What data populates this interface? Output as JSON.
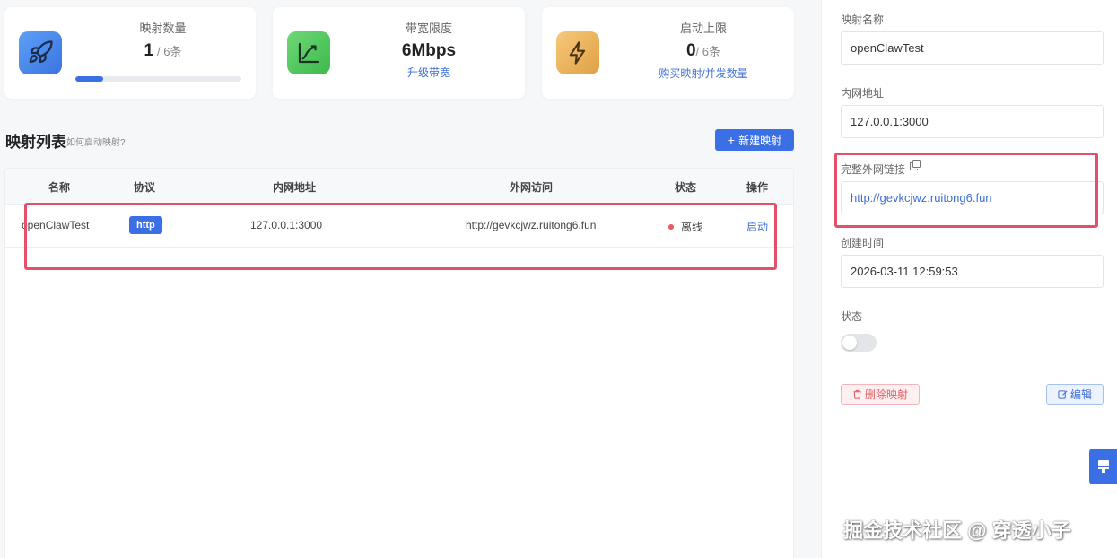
{
  "stats": {
    "mappings": {
      "title": "映射数量",
      "value": "1",
      "sub": "/ 6条",
      "progress": 0.167,
      "icon": "rocket-icon"
    },
    "bandwidth": {
      "title": "带宽限度",
      "value": "6Mbps",
      "link": "升级带宽",
      "icon": "chart-trend-icon"
    },
    "launch": {
      "title": "启动上限",
      "value": "0",
      "sub": "/ 6条",
      "link": "购买映射/并发数量",
      "icon": "lightning-icon"
    }
  },
  "list": {
    "title": "映射列表",
    "hint": "如何启动映射?",
    "new_button": "新建映射",
    "columns": [
      "名称",
      "协议",
      "内网地址",
      "外网访问",
      "状态",
      "操作"
    ],
    "rows": [
      {
        "name": "openClawTest",
        "protocol": "http",
        "internal": "127.0.0.1:3000",
        "external": "http://gevkcjwz.ruitong6.fun",
        "status": "离线",
        "action": "启动"
      }
    ]
  },
  "detail": {
    "name_label": "映射名称",
    "name_value": "openClawTest",
    "internal_label": "内网地址",
    "internal_value": "127.0.0.1:3000",
    "external_label": "完整外网链接",
    "external_value": "http://gevkcjwz.ruitong6.fun",
    "created_label": "创建时间",
    "created_value": "2026-03-11 12:59:53",
    "status_label": "状态",
    "status_on": false,
    "delete_button": "删除映射",
    "edit_button": "编辑"
  },
  "watermark": "掘金技术社区 @ 穿透小子",
  "colors": {
    "primary": "#3a6fe6",
    "danger": "#e55a64",
    "highlight": "#e4506a"
  }
}
